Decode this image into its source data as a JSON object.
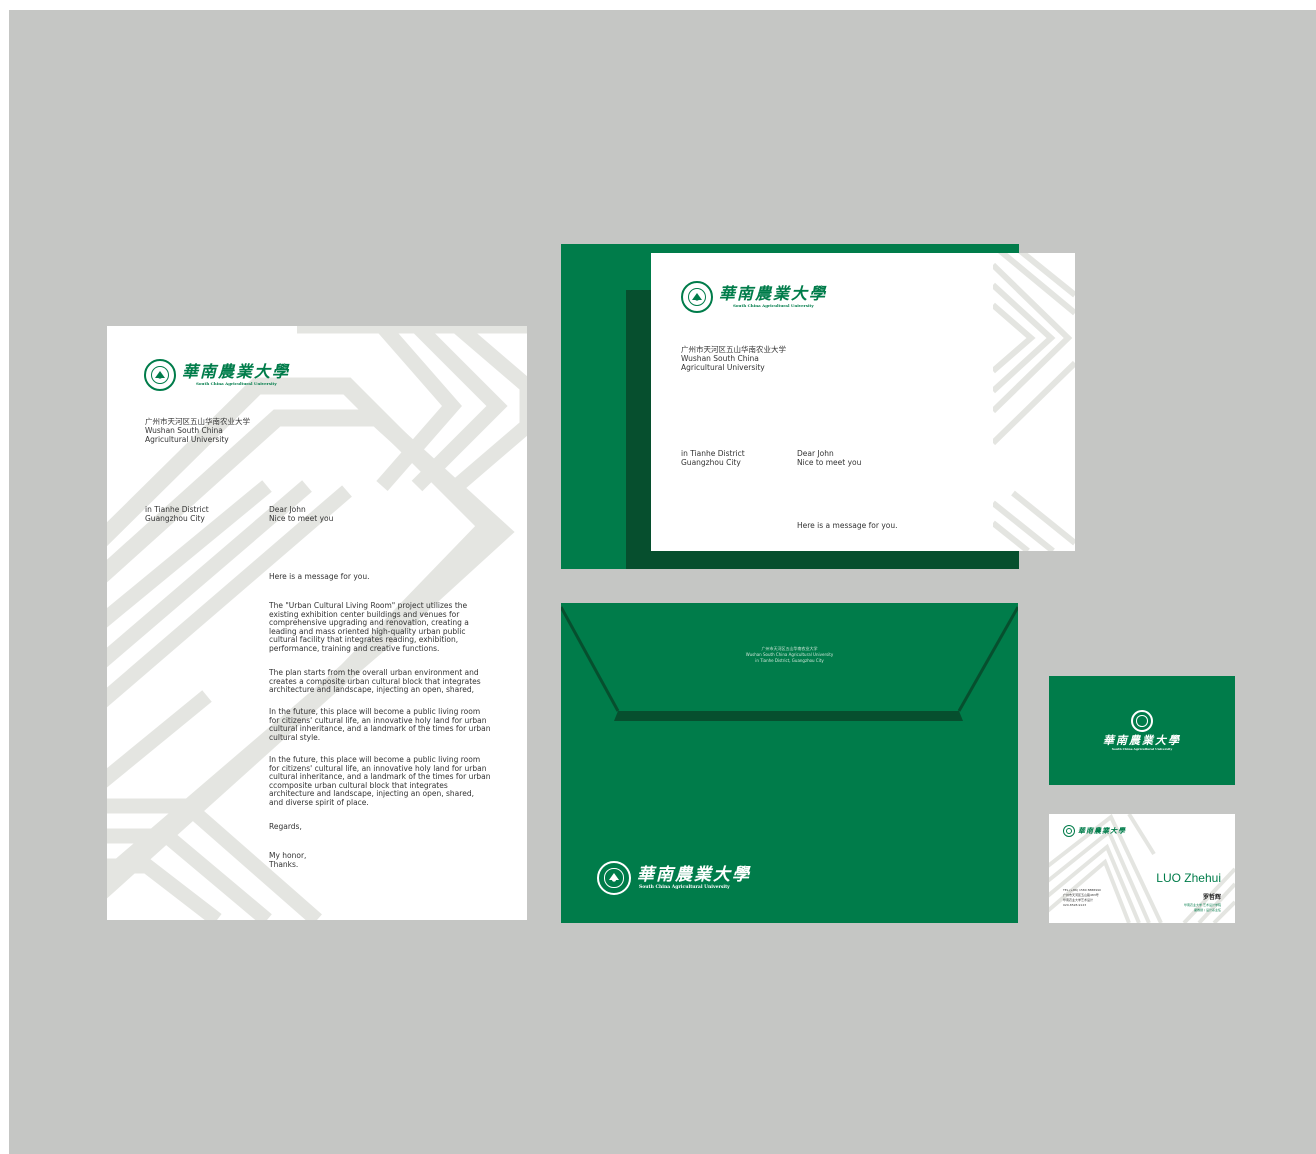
{
  "colors": {
    "green": "#007c4a",
    "dark_green": "#064f2e",
    "stripe": "#e4e5e1",
    "background": "#c5c6c4"
  },
  "logo": {
    "name_cn": "華南農業大學",
    "name_en": "South China Agricultural University",
    "icon": "university-seal-icon"
  },
  "letterhead": {
    "address_cn": "广州市天河区五山华南农业大学",
    "address_en": "Wushan South China\nAgricultural University",
    "district": "in Tianhe District\nGuangzhou City",
    "greeting": "Dear John\nNice to meet you",
    "message": "Here is a message for you.",
    "paragraphs": [
      "The \"Urban Cultural Living Room\" project utilizes the\nexisting exhibition center buildings and venues for\ncomprehensive upgrading and renovation, creating a\nleading and mass oriented high-quality urban public\ncultural facility that integrates reading, exhibition,\nperformance, training and creative functions.",
      "The plan starts from the overall urban environment and\ncreates a composite urban cultural block that integrates\narchitecture and landscape, injecting an open, shared,",
      "In the future, this place will become a public living room\nfor citizens' cultural life, an innovative holy land for urban\ncultural inheritance, and a landmark of the times for urban\ncultural style.",
      "In the future, this place will become a public living room\nfor citizens' cultural life, an innovative holy land for urban\ncultural inheritance, and a landmark of the times for urban\nccomposite urban cultural block that integrates\narchitecture and landscape, injecting an open, shared,\nand diverse spirit of place."
    ],
    "regards": "Regards,",
    "signoff": "My honor,\nThanks."
  },
  "envelope_back": {
    "flap_line1": "广州市天河区五山华南农业大学",
    "flap_line2": "Wushan South China Agricultural University",
    "flap_line3": "in Tianhe District, Guangzhou City"
  },
  "business_card": {
    "name_en": "LUO Zhehui",
    "name_cn": "罗哲辉",
    "contact": "TEL (+86) 1580 8888990\n广州市天河区五山路483号\n华南农业大学艺术设计\n020-8528-9123",
    "title": "华南农业大学 艺术设计学院\n副教授 / 设计系主任"
  }
}
